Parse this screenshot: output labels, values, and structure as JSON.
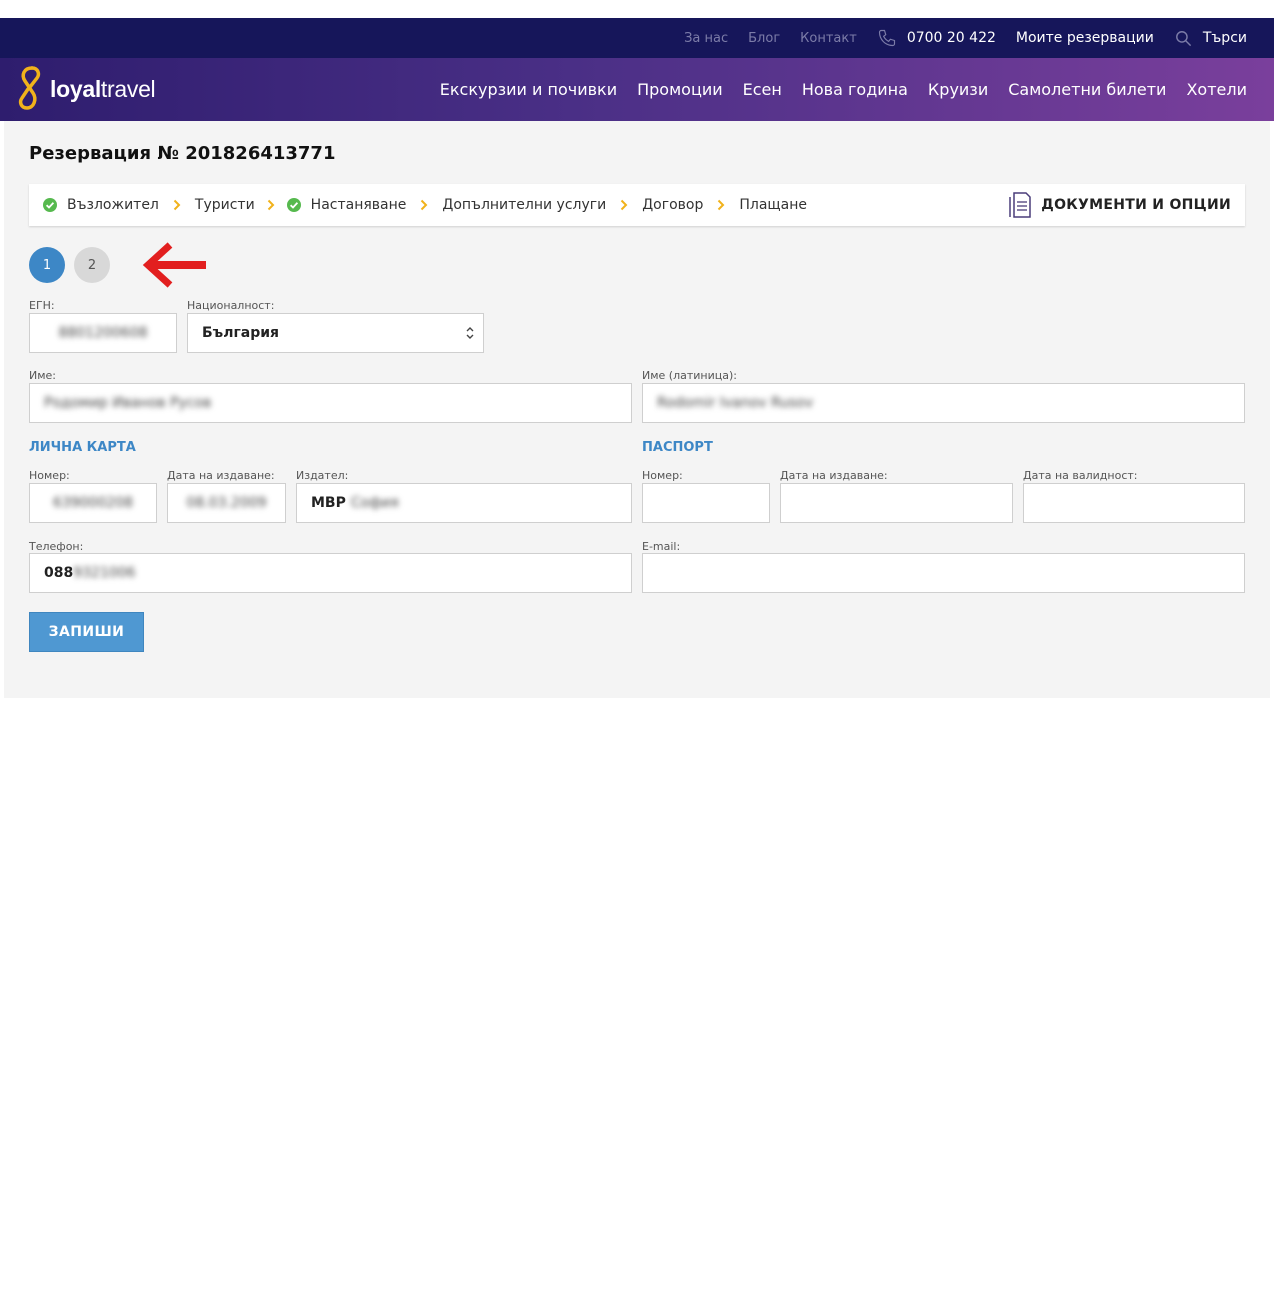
{
  "topbar": {
    "links": [
      "За нас",
      "Блог",
      "Контакт"
    ],
    "phone": "0700 20 422",
    "my_reservations": "Моите резервации",
    "search": "Търси"
  },
  "brand": {
    "part1": "loyal",
    "part2": "travel"
  },
  "nav": [
    "Екскурзии и почивки",
    "Промоции",
    "Есен",
    "Нова година",
    "Круизи",
    "Самолетни билети",
    "Хотели"
  ],
  "reservation": {
    "title": "Резервация № 201826413771"
  },
  "steps": [
    {
      "label": "Възложител",
      "done": true
    },
    {
      "label": "Туристи",
      "done": false
    },
    {
      "label": "Настаняване",
      "done": true
    },
    {
      "label": "Допълнителни услуги",
      "done": false
    },
    {
      "label": "Договор",
      "done": false
    },
    {
      "label": "Плащане",
      "done": false
    }
  ],
  "documents_label": "ДОКУМЕНТИ И ОПЦИИ",
  "pager": [
    "1",
    "2"
  ],
  "form": {
    "egn": {
      "label": "ЕГН:",
      "value": "8801200608"
    },
    "nationality": {
      "label": "Националност:",
      "value": "България"
    },
    "name": {
      "label": "Име:",
      "value": "Родомир Иванов Русов"
    },
    "name_latin": {
      "label": "Име (латиница):",
      "value": "Rodomir Ivanov Rusov"
    },
    "id_card": {
      "title": "ЛИЧНА КАРТА",
      "number": {
        "label": "Номер:",
        "value": "639000208"
      },
      "issue_date": {
        "label": "Дата на издаване:",
        "value": "08.03.2009"
      },
      "issuer": {
        "label": "Издател:",
        "value_prefix": "МВР",
        "value_rest": "София"
      }
    },
    "passport": {
      "title": "ПАСПОРТ",
      "number": {
        "label": "Номер:",
        "value": ""
      },
      "issue_date": {
        "label": "Дата на издаване:",
        "value": ""
      },
      "valid_date": {
        "label": "Дата на валидност:",
        "value": ""
      }
    },
    "phone": {
      "label": "Телефон:",
      "value_prefix": "088",
      "value_rest": "9321006"
    },
    "email": {
      "label": "E-mail:",
      "value": ""
    }
  },
  "save_label": "ЗАПИШИ",
  "colors": {
    "topbar": "#16165a",
    "accent": "#3d87c6",
    "check": "#56b94e",
    "chevron": "#f1b21b",
    "arrow": "#e21f1f"
  }
}
